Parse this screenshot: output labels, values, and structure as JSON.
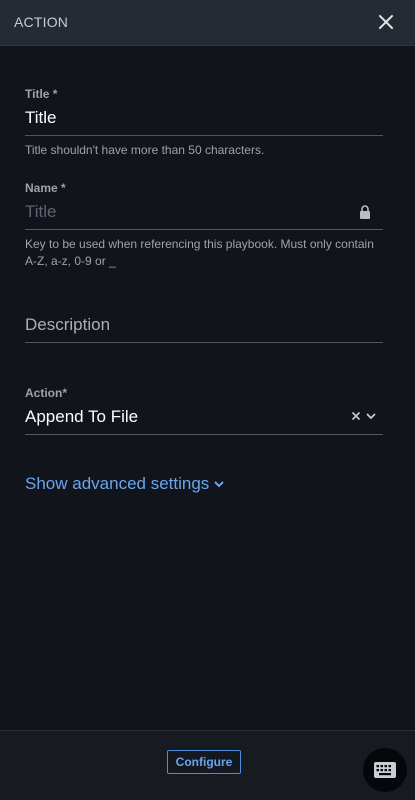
{
  "header": {
    "title": "ACTION",
    "close_icon": "close-icon"
  },
  "title_field": {
    "label": "Title *",
    "value": "Title",
    "helper": "Title shouldn't have more than 50 characters."
  },
  "name_field": {
    "label": "Name *",
    "placeholder": "Title",
    "locked": true,
    "helper": "Key to be used when referencing this playbook. Must only contain A-Z, a-z, 0-9 or _"
  },
  "description_field": {
    "label": "Description"
  },
  "action_field": {
    "label": "Action*",
    "value": "Append To File"
  },
  "advanced": {
    "label": "Show advanced settings"
  },
  "footer": {
    "configure_label": "Configure"
  },
  "colors": {
    "accent": "#6aa5f0",
    "background": "#11141b",
    "header": "#252a33"
  }
}
